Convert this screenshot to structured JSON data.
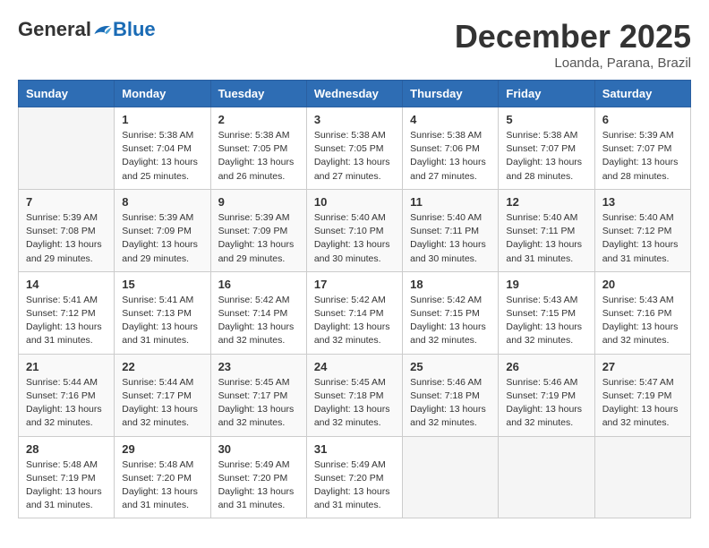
{
  "header": {
    "logo": {
      "general": "General",
      "blue": "Blue"
    },
    "title": "December 2025",
    "subtitle": "Loanda, Parana, Brazil"
  },
  "days_of_week": [
    "Sunday",
    "Monday",
    "Tuesday",
    "Wednesday",
    "Thursday",
    "Friday",
    "Saturday"
  ],
  "weeks": [
    [
      {
        "day": "",
        "sunrise": "",
        "sunset": "",
        "daylight": ""
      },
      {
        "day": "1",
        "sunrise": "Sunrise: 5:38 AM",
        "sunset": "Sunset: 7:04 PM",
        "daylight": "Daylight: 13 hours and 25 minutes."
      },
      {
        "day": "2",
        "sunrise": "Sunrise: 5:38 AM",
        "sunset": "Sunset: 7:05 PM",
        "daylight": "Daylight: 13 hours and 26 minutes."
      },
      {
        "day": "3",
        "sunrise": "Sunrise: 5:38 AM",
        "sunset": "Sunset: 7:05 PM",
        "daylight": "Daylight: 13 hours and 27 minutes."
      },
      {
        "day": "4",
        "sunrise": "Sunrise: 5:38 AM",
        "sunset": "Sunset: 7:06 PM",
        "daylight": "Daylight: 13 hours and 27 minutes."
      },
      {
        "day": "5",
        "sunrise": "Sunrise: 5:38 AM",
        "sunset": "Sunset: 7:07 PM",
        "daylight": "Daylight: 13 hours and 28 minutes."
      },
      {
        "day": "6",
        "sunrise": "Sunrise: 5:39 AM",
        "sunset": "Sunset: 7:07 PM",
        "daylight": "Daylight: 13 hours and 28 minutes."
      }
    ],
    [
      {
        "day": "7",
        "sunrise": "Sunrise: 5:39 AM",
        "sunset": "Sunset: 7:08 PM",
        "daylight": "Daylight: 13 hours and 29 minutes."
      },
      {
        "day": "8",
        "sunrise": "Sunrise: 5:39 AM",
        "sunset": "Sunset: 7:09 PM",
        "daylight": "Daylight: 13 hours and 29 minutes."
      },
      {
        "day": "9",
        "sunrise": "Sunrise: 5:39 AM",
        "sunset": "Sunset: 7:09 PM",
        "daylight": "Daylight: 13 hours and 29 minutes."
      },
      {
        "day": "10",
        "sunrise": "Sunrise: 5:40 AM",
        "sunset": "Sunset: 7:10 PM",
        "daylight": "Daylight: 13 hours and 30 minutes."
      },
      {
        "day": "11",
        "sunrise": "Sunrise: 5:40 AM",
        "sunset": "Sunset: 7:11 PM",
        "daylight": "Daylight: 13 hours and 30 minutes."
      },
      {
        "day": "12",
        "sunrise": "Sunrise: 5:40 AM",
        "sunset": "Sunset: 7:11 PM",
        "daylight": "Daylight: 13 hours and 31 minutes."
      },
      {
        "day": "13",
        "sunrise": "Sunrise: 5:40 AM",
        "sunset": "Sunset: 7:12 PM",
        "daylight": "Daylight: 13 hours and 31 minutes."
      }
    ],
    [
      {
        "day": "14",
        "sunrise": "Sunrise: 5:41 AM",
        "sunset": "Sunset: 7:12 PM",
        "daylight": "Daylight: 13 hours and 31 minutes."
      },
      {
        "day": "15",
        "sunrise": "Sunrise: 5:41 AM",
        "sunset": "Sunset: 7:13 PM",
        "daylight": "Daylight: 13 hours and 31 minutes."
      },
      {
        "day": "16",
        "sunrise": "Sunrise: 5:42 AM",
        "sunset": "Sunset: 7:14 PM",
        "daylight": "Daylight: 13 hours and 32 minutes."
      },
      {
        "day": "17",
        "sunrise": "Sunrise: 5:42 AM",
        "sunset": "Sunset: 7:14 PM",
        "daylight": "Daylight: 13 hours and 32 minutes."
      },
      {
        "day": "18",
        "sunrise": "Sunrise: 5:42 AM",
        "sunset": "Sunset: 7:15 PM",
        "daylight": "Daylight: 13 hours and 32 minutes."
      },
      {
        "day": "19",
        "sunrise": "Sunrise: 5:43 AM",
        "sunset": "Sunset: 7:15 PM",
        "daylight": "Daylight: 13 hours and 32 minutes."
      },
      {
        "day": "20",
        "sunrise": "Sunrise: 5:43 AM",
        "sunset": "Sunset: 7:16 PM",
        "daylight": "Daylight: 13 hours and 32 minutes."
      }
    ],
    [
      {
        "day": "21",
        "sunrise": "Sunrise: 5:44 AM",
        "sunset": "Sunset: 7:16 PM",
        "daylight": "Daylight: 13 hours and 32 minutes."
      },
      {
        "day": "22",
        "sunrise": "Sunrise: 5:44 AM",
        "sunset": "Sunset: 7:17 PM",
        "daylight": "Daylight: 13 hours and 32 minutes."
      },
      {
        "day": "23",
        "sunrise": "Sunrise: 5:45 AM",
        "sunset": "Sunset: 7:17 PM",
        "daylight": "Daylight: 13 hours and 32 minutes."
      },
      {
        "day": "24",
        "sunrise": "Sunrise: 5:45 AM",
        "sunset": "Sunset: 7:18 PM",
        "daylight": "Daylight: 13 hours and 32 minutes."
      },
      {
        "day": "25",
        "sunrise": "Sunrise: 5:46 AM",
        "sunset": "Sunset: 7:18 PM",
        "daylight": "Daylight: 13 hours and 32 minutes."
      },
      {
        "day": "26",
        "sunrise": "Sunrise: 5:46 AM",
        "sunset": "Sunset: 7:19 PM",
        "daylight": "Daylight: 13 hours and 32 minutes."
      },
      {
        "day": "27",
        "sunrise": "Sunrise: 5:47 AM",
        "sunset": "Sunset: 7:19 PM",
        "daylight": "Daylight: 13 hours and 32 minutes."
      }
    ],
    [
      {
        "day": "28",
        "sunrise": "Sunrise: 5:48 AM",
        "sunset": "Sunset: 7:19 PM",
        "daylight": "Daylight: 13 hours and 31 minutes."
      },
      {
        "day": "29",
        "sunrise": "Sunrise: 5:48 AM",
        "sunset": "Sunset: 7:20 PM",
        "daylight": "Daylight: 13 hours and 31 minutes."
      },
      {
        "day": "30",
        "sunrise": "Sunrise: 5:49 AM",
        "sunset": "Sunset: 7:20 PM",
        "daylight": "Daylight: 13 hours and 31 minutes."
      },
      {
        "day": "31",
        "sunrise": "Sunrise: 5:49 AM",
        "sunset": "Sunset: 7:20 PM",
        "daylight": "Daylight: 13 hours and 31 minutes."
      },
      {
        "day": "",
        "sunrise": "",
        "sunset": "",
        "daylight": ""
      },
      {
        "day": "",
        "sunrise": "",
        "sunset": "",
        "daylight": ""
      },
      {
        "day": "",
        "sunrise": "",
        "sunset": "",
        "daylight": ""
      }
    ]
  ]
}
